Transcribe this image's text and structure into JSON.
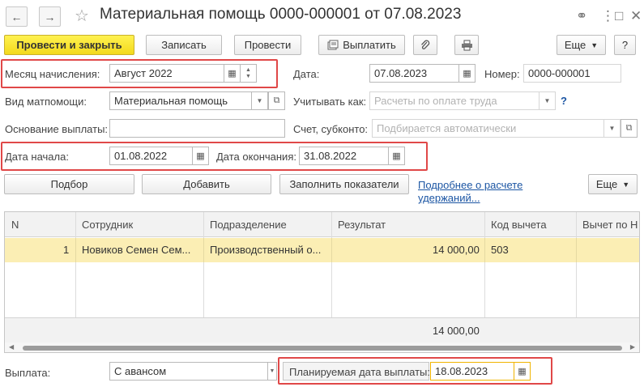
{
  "window": {
    "title": "Материальная помощь 0000-000001 от 07.08.2023",
    "nav_back": "←",
    "nav_forward": "→",
    "star": "☆",
    "link_icon": "⚭",
    "more_icon": "⋮",
    "maximize_icon": "□",
    "close_icon": "✕"
  },
  "toolbar": {
    "post_and_close": "Провести и закрыть",
    "save": "Записать",
    "post": "Провести",
    "pay": "Выплатить",
    "more": "Еще",
    "help": "?"
  },
  "form": {
    "month_label": "Месяц начисления:",
    "month_value": "Август 2022",
    "date_label": "Дата:",
    "date_value": "07.08.2023",
    "number_label": "Номер:",
    "number_value": "0000-000001",
    "aid_type_label": "Вид матпомощи:",
    "aid_type_value": "Материальная помощь",
    "account_as_label": "Учитывать как:",
    "account_as_placeholder": "Расчеты по оплате труда",
    "help_q": "?",
    "basis_label": "Основание выплаты:",
    "basis_value": "",
    "account_label": "Счет, субконто:",
    "account_placeholder": "Подбирается автоматически",
    "start_label": "Дата начала:",
    "start_value": "01.08.2022",
    "end_label": "Дата окончания:",
    "end_value": "31.08.2022"
  },
  "table_toolbar": {
    "pick": "Подбор",
    "add": "Добавить",
    "fill": "Заполнить показатели",
    "more_link": "Подробнее о расчете удержаний...",
    "more": "Еще"
  },
  "table": {
    "columns": [
      "N",
      "Сотрудник",
      "Подразделение",
      "Результат",
      "Код вычета",
      "Вычет по Н"
    ],
    "rows": [
      {
        "n": "1",
        "employee": "Новиков Семен Сем...",
        "department": "Производственный о...",
        "result": "14 000,00",
        "code": "503",
        "deduction": ""
      }
    ],
    "total_result": "14 000,00"
  },
  "bottom": {
    "payment_label": "Выплата:",
    "payment_value": "С авансом",
    "planned_date_label": "Планируемая дата выплаты:",
    "planned_date_value": "18.08.2023"
  },
  "colors": {
    "primary_button": "#f3d91c",
    "highlight_box": "#e04848",
    "selected_row": "#fbeeb4",
    "link": "#1b55a3"
  }
}
